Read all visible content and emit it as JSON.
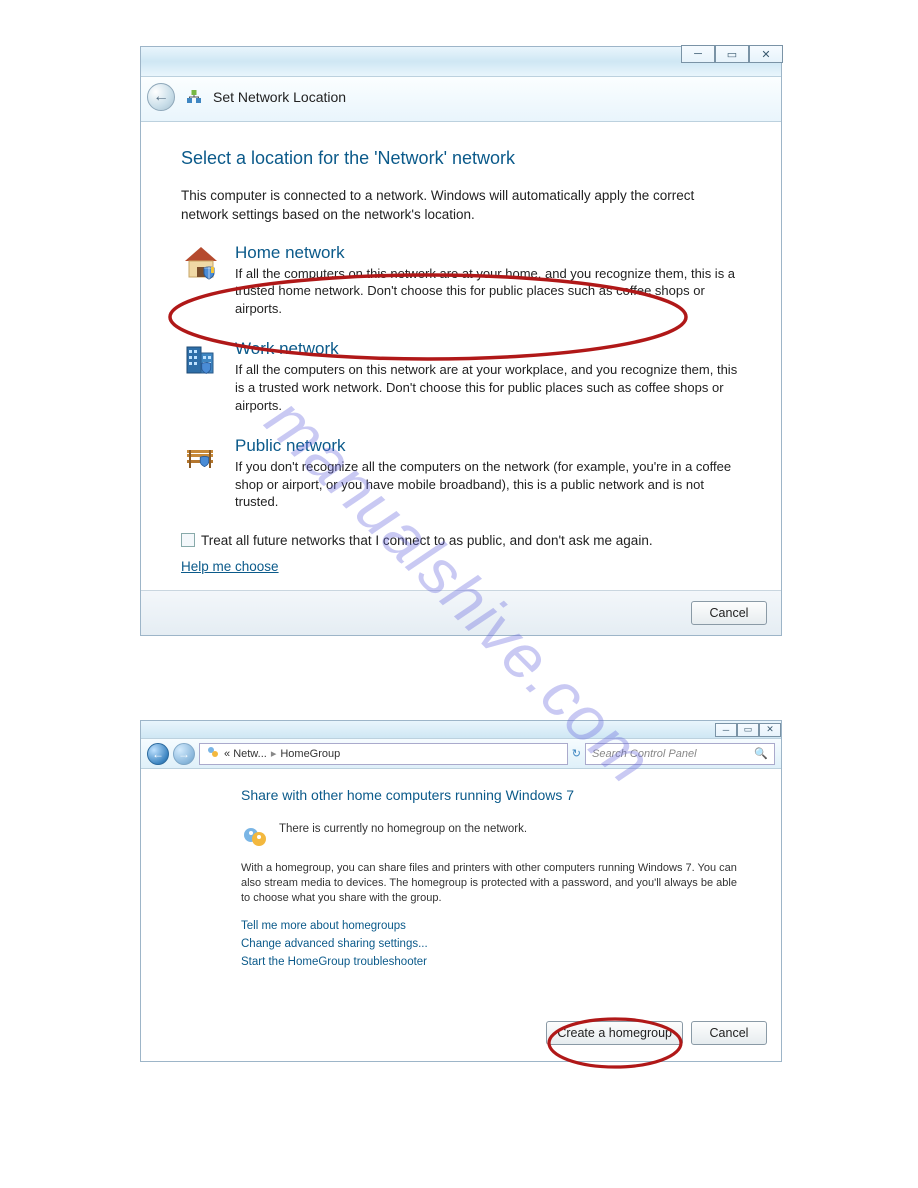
{
  "watermark": "manualshive.com",
  "dlg1": {
    "window_title": "Set Network Location",
    "heading": "Select a location for the 'Network' network",
    "intro": "This computer is connected to a network. Windows will automatically apply the correct network settings based on the network's location.",
    "options": [
      {
        "title": "Home network",
        "desc": "If all the computers on this network are at your home, and you recognize them, this is a trusted home network.  Don't choose this for public places such as coffee shops or airports."
      },
      {
        "title": "Work network",
        "desc": "If all the computers on this network are at your workplace, and you recognize them, this is a trusted work network.  Don't choose this for public places such as coffee shops or airports."
      },
      {
        "title": "Public network",
        "desc": "If you don't recognize all the computers on the network (for example, you're in a coffee shop or airport, or you have mobile broadband), this is a public network and is not trusted."
      }
    ],
    "treat_label": "Treat all future networks that I connect to as public, and don't ask me again.",
    "help_link": "Help me choose",
    "cancel": "Cancel"
  },
  "dlg2": {
    "breadcrumb": {
      "part1": "Netw...",
      "part2": "HomeGroup"
    },
    "search_placeholder": "Search Control Panel",
    "heading": "Share with other home computers running Windows 7",
    "no_hg": "There is currently no homegroup on the network.",
    "desc": "With a homegroup, you can share files and printers with other computers running Windows 7. You can also stream media to devices. The homegroup is protected with a password, and you'll always be able to choose what you share with the group.",
    "links": [
      "Tell me more about homegroups",
      "Change advanced sharing settings...",
      "Start the HomeGroup troubleshooter"
    ],
    "create": "Create a homegroup",
    "cancel": "Cancel"
  }
}
